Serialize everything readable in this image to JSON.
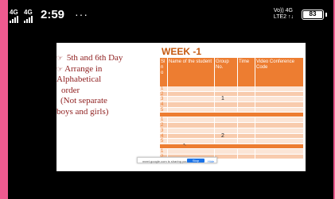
{
  "status_bar": {
    "left_net1": "4G",
    "left_net2": "4G",
    "time": "2:59",
    "dots": "···",
    "right_line1": "Vo)) 4G",
    "right_line2": "LTE2 ↑↓",
    "battery": "83"
  },
  "slide": {
    "left_lines": [
      "5th and 6th Day",
      "Arrange in",
      "Alphabetical",
      "order",
      "(Not separate",
      "boys and girls)"
    ],
    "title": "WEEK -1",
    "headers": [
      "Sl n o",
      "Name of the student",
      "Group No.",
      "Time",
      "Video Conference Code"
    ],
    "group1": {
      "rows": [
        "1",
        "2",
        "3",
        "4",
        "5"
      ],
      "label": "1"
    },
    "group2": {
      "rows": [
        "1",
        "2",
        "3",
        "4",
        "5"
      ],
      "label": "2"
    },
    "group3": {
      "rows": [
        "1",
        "2"
      ]
    }
  },
  "toast": {
    "message": "meet.google.com is sharing your screen.",
    "stop_label": "Stop sharing",
    "hide_label": "Hide"
  },
  "colors": {
    "accent": "#ed7d31",
    "row_light": "#fbe5d6",
    "row_mid": "#f8cbad",
    "title": "#c55a11",
    "text": "#8e1d1d",
    "pink": "#ee5a8f"
  }
}
